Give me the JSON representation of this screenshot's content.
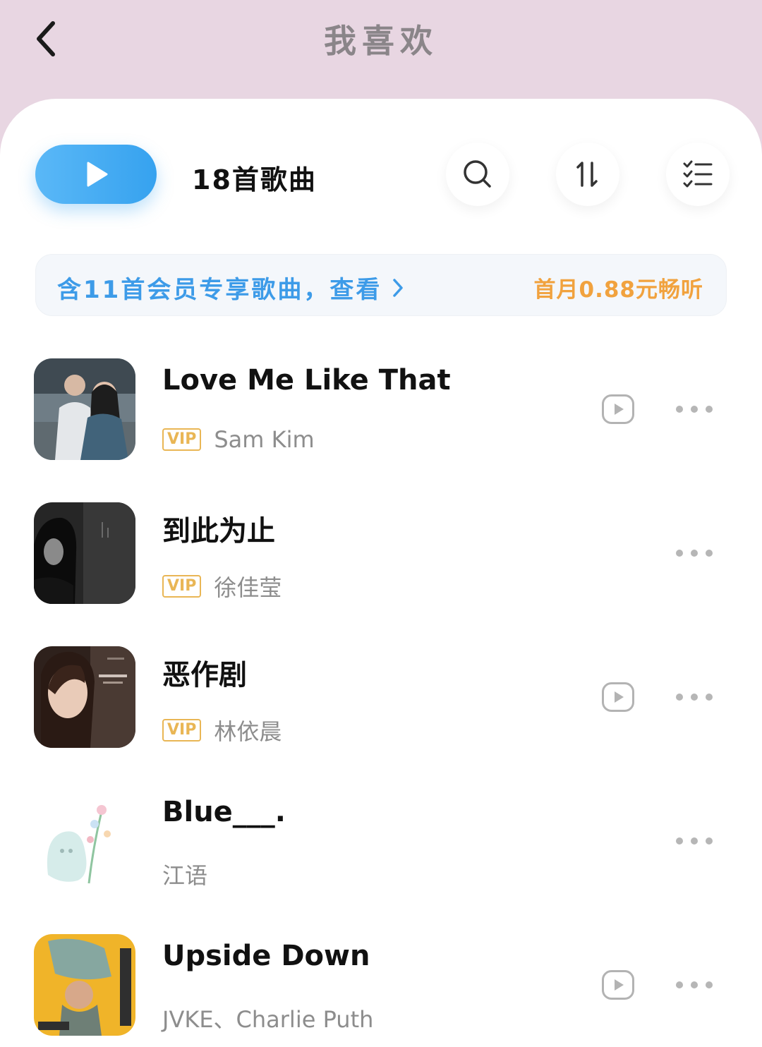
{
  "header": {
    "title": "我喜欢"
  },
  "toolbar": {
    "song_count": "18首歌曲"
  },
  "vip_banner": {
    "left_text": "含11首会员专享歌曲，查看",
    "right_text": "首月0.88元畅听"
  },
  "songs": [
    {
      "title": "Love Me Like That",
      "vip": "VIP",
      "artist": "Sam Kim",
      "has_mv": true
    },
    {
      "title": "到此为止",
      "vip": "VIP",
      "artist": "徐佳莹",
      "has_mv": false
    },
    {
      "title": "恶作剧",
      "vip": "VIP",
      "artist": "林依晨",
      "has_mv": true
    },
    {
      "title": "Blue___.",
      "vip": "",
      "artist": "江语",
      "has_mv": false
    },
    {
      "title": "Upside Down",
      "vip": "",
      "artist": "JVKE、Charlie Puth",
      "has_mv": true
    }
  ],
  "colors": {
    "accent_blue": "#3d9be8",
    "vip_orange": "#f1a23e",
    "vip_tag": "#e9b655",
    "top_bg": "#e8d6e2"
  }
}
